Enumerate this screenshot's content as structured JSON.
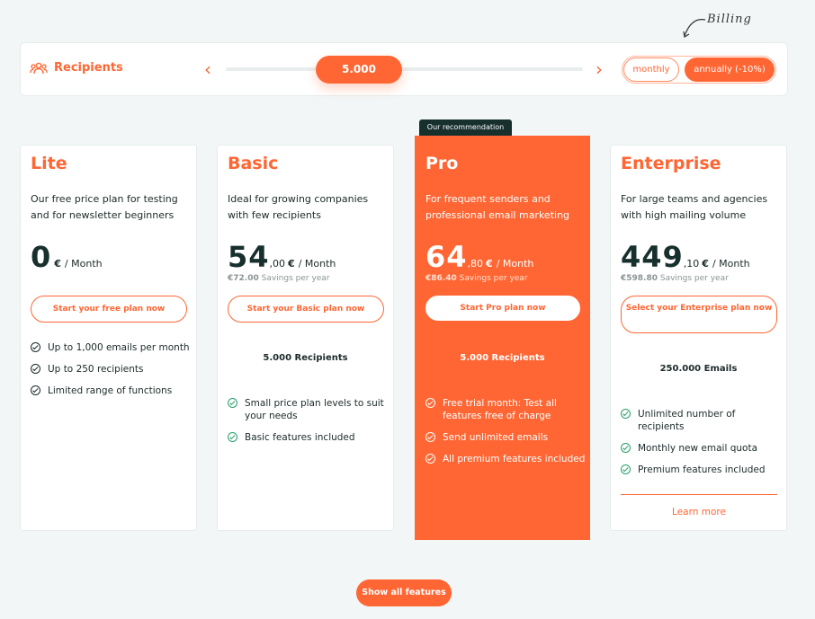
{
  "billing_note": "Billing",
  "header": {
    "recipients_label": "Recipients",
    "slider_value": "5.000",
    "prev_icon": "chevron-left-icon",
    "next_icon": "chevron-right-icon",
    "prev_glyph": "‹",
    "next_glyph": "›",
    "billing_monthly": "monthly",
    "billing_annual": "annually (-10%)"
  },
  "recommendation_badge": "Our recommendation",
  "plans": [
    {
      "name": "Lite",
      "description": "Our free price plan for testing and for newsletter beginners",
      "price_main": "0",
      "price_cents": "",
      "currency": "€",
      "per": "/ Month",
      "cta": "Start your free plan now",
      "features": [
        "Up to 1,000 emails per month",
        "Up to 250 recipients",
        "Limited range of functions"
      ]
    },
    {
      "name": "Basic",
      "description": "Ideal for growing companies with few recipients",
      "price_main": "54",
      "price_cents": ",00",
      "currency": "€",
      "per": "/ Month",
      "savings_amount": "€72.00",
      "savings_text": "Savings per year",
      "cta": "Start your Basic plan now",
      "recipients": "5.000 Recipients",
      "features": [
        "Small price plan levels to suit your needs",
        "Basic features included"
      ]
    },
    {
      "name": "Pro",
      "description": "For frequent senders and professional email marketing",
      "price_main": "64",
      "price_cents": ",80",
      "currency": "€",
      "per": "/ Month",
      "savings_amount": "€86.40",
      "savings_text": "Savings per year",
      "cta": "Start Pro plan now",
      "recipients": "5.000 Recipients",
      "features": [
        "Free trial month: Test all features free of charge",
        "Send unlimited emails",
        "All premium features included"
      ]
    },
    {
      "name": "Enterprise",
      "description": "For large teams and agencies with high mailing volume",
      "price_main": "449",
      "price_cents": ",10",
      "currency": "€",
      "per": "/ Month",
      "savings_amount": "€598.80",
      "savings_text": "Savings per year",
      "cta": "Select your Enterprise plan now",
      "recipients": "250.000 Emails",
      "features": [
        "Unlimited number of recipients",
        "Monthly new email quota",
        "Premium features included"
      ],
      "learn_more": "Learn more"
    }
  ],
  "show_all": "Show all features",
  "colors": {
    "accent": "#ff6633",
    "dark": "#17302e",
    "check_green": "#27a169",
    "background": "#f2f6f6"
  }
}
